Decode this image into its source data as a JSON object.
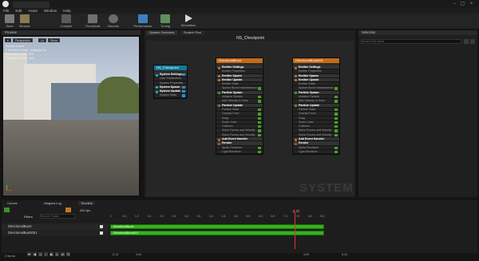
{
  "window": {
    "minimize": "−",
    "maximize": "▢",
    "close": "×"
  },
  "menu": [
    "File",
    "Edit",
    "Asset",
    "Window",
    "Help"
  ],
  "toolbar": {
    "save": "Save",
    "browse": "Browse",
    "thumbnail": "Thumbnail",
    "bounds": "Bounds",
    "performance": "Performance",
    "tuning": "Tuning",
    "simulation": "Simulation",
    "compile": "Compile"
  },
  "preview": {
    "tab": "Preview",
    "btn_persp": "Perspective",
    "btn_lit": "Lit",
    "btn_show": "Show",
    "lines": [
      "Particle Count",
      "0 (Particles Stats) - Instance No",
      "Expected Count - N/A",
      "Estimated Count - N/A"
    ]
  },
  "graph": {
    "tab": "System Overview",
    "scratch_tab": "Scratch Pad",
    "title": "NS_Checkpoint",
    "watermark": "SYSTEM"
  },
  "system_node": {
    "title": "NS_Checkpoint",
    "rows": [
      {
        "label": "System Settings",
        "type": "sec",
        "dot": "#2fb3d6",
        "chk": "b"
      },
      {
        "label": "User Parameters",
        "type": "mod",
        "dot": "",
        "chk": ""
      },
      {
        "label": "System Properties",
        "type": "mod",
        "dot": "",
        "chk": ""
      },
      {
        "label": "System Spawn",
        "type": "sec",
        "dot": "#2fb3d6",
        "chk": "b"
      },
      {
        "label": "System Update",
        "type": "sec",
        "dot": "#2fb3d6",
        "chk": "b"
      },
      {
        "label": "System State",
        "type": "mod",
        "dot": "",
        "chk": "b"
      }
    ]
  },
  "emitter_nodes": [
    {
      "title": "DirectionalBurst",
      "rows": [
        {
          "label": "Emitter Settings",
          "type": "sec",
          "dot": "#c9742a",
          "chk": ""
        },
        {
          "label": "Emitter Properties",
          "type": "mod",
          "dot": "",
          "chk": ""
        },
        {
          "label": "Emitter Spawn",
          "type": "sec",
          "dot": "#c9742a",
          "chk": ""
        },
        {
          "label": "Emitter Update",
          "type": "sec",
          "dot": "#c9742a",
          "chk": ""
        },
        {
          "label": "Emitter State",
          "type": "mod",
          "dot": "",
          "chk": ""
        },
        {
          "label": "Spawn Burst Instantaneous",
          "type": "mod",
          "dot": "",
          "chk": "g"
        },
        {
          "label": "Particle Spawn",
          "type": "sec",
          "dot": "#4aa02c",
          "chk": ""
        },
        {
          "label": "Initialize Particle",
          "type": "mod",
          "dot": "",
          "chk": "g"
        },
        {
          "label": "Add Velocity in Cone",
          "type": "mod",
          "dot": "",
          "chk": "g"
        },
        {
          "label": "Particle Update",
          "type": "sec",
          "dot": "#4aa02c",
          "chk": ""
        },
        {
          "label": "Particle State",
          "type": "mod",
          "dot": "",
          "chk": "g"
        },
        {
          "label": "Gravity Force",
          "type": "mod",
          "dot": "",
          "chk": "g"
        },
        {
          "label": "Drag",
          "type": "mod",
          "dot": "",
          "chk": "g"
        },
        {
          "label": "Scale Color",
          "type": "mod",
          "dot": "",
          "chk": "g"
        },
        {
          "label": "Collision",
          "type": "mod",
          "dot": "",
          "chk": "g"
        },
        {
          "label": "Solve Forces and Velocity",
          "type": "mod",
          "dot": "",
          "chk": "g"
        },
        {
          "label": "Solve Forces and Velocity",
          "type": "mod",
          "dot": "",
          "chk": "g"
        },
        {
          "label": "Add Event Handler",
          "type": "sec",
          "dot": "#c9742a",
          "chk": ""
        },
        {
          "label": "Render",
          "type": "sec",
          "dot": "#c94a3a",
          "chk": ""
        },
        {
          "label": "Sprite Renderer",
          "type": "mod",
          "dot": "",
          "chk": "g"
        },
        {
          "label": "Light Renderer",
          "type": "mod",
          "dot": "",
          "chk": "g"
        }
      ]
    },
    {
      "title": "DirectionalBurst001",
      "rows": [
        {
          "label": "Emitter Settings",
          "type": "sec",
          "dot": "#c9742a",
          "chk": ""
        },
        {
          "label": "Emitter Properties",
          "type": "mod",
          "dot": "",
          "chk": ""
        },
        {
          "label": "Emitter Spawn",
          "type": "sec",
          "dot": "#c9742a",
          "chk": ""
        },
        {
          "label": "Emitter Update",
          "type": "sec",
          "dot": "#c9742a",
          "chk": ""
        },
        {
          "label": "Emitter State",
          "type": "mod",
          "dot": "",
          "chk": ""
        },
        {
          "label": "Spawn Burst Instantaneous",
          "type": "mod",
          "dot": "",
          "chk": "g"
        },
        {
          "label": "Particle Spawn",
          "type": "sec",
          "dot": "#4aa02c",
          "chk": ""
        },
        {
          "label": "Initialize Particle",
          "type": "mod",
          "dot": "",
          "chk": "g"
        },
        {
          "label": "Add Velocity in Cone",
          "type": "mod",
          "dot": "",
          "chk": "g"
        },
        {
          "label": "Particle Update",
          "type": "sec",
          "dot": "#4aa02c",
          "chk": ""
        },
        {
          "label": "Particle State",
          "type": "mod",
          "dot": "",
          "chk": "g"
        },
        {
          "label": "Gravity Force",
          "type": "mod",
          "dot": "",
          "chk": "g"
        },
        {
          "label": "Drag",
          "type": "mod",
          "dot": "",
          "chk": "g"
        },
        {
          "label": "Scale Color",
          "type": "mod",
          "dot": "",
          "chk": "g"
        },
        {
          "label": "Collision",
          "type": "mod",
          "dot": "",
          "chk": "g"
        },
        {
          "label": "Solve Forces and Velocity",
          "type": "mod",
          "dot": "",
          "chk": "g"
        },
        {
          "label": "Solve Forces and Velocity",
          "type": "mod",
          "dot": "",
          "chk": "g"
        },
        {
          "label": "Add Event Handler",
          "type": "sec",
          "dot": "#c9742a",
          "chk": ""
        },
        {
          "label": "Render",
          "type": "sec",
          "dot": "#c94a3a",
          "chk": ""
        },
        {
          "label": "Sprite Renderer",
          "type": "mod",
          "dot": "",
          "chk": "g"
        },
        {
          "label": "Light Renderer",
          "type": "mod",
          "dot": "",
          "chk": "g"
        }
      ]
    }
  ],
  "selection": {
    "tab": "Selection",
    "search_placeholder": "Search the stack"
  },
  "timeline": {
    "tabs": [
      "Curves",
      "Niagara Log",
      "Timeline"
    ],
    "filters": "Filters",
    "search_placeholder": "Search Tracks",
    "fps": "240 fps",
    "playhead": "0.72",
    "tracks": [
      "DirectionalBurst",
      "DirectionalBurst001"
    ],
    "bars": [
      "DirectionalBurst",
      "DirectionalBurst001"
    ],
    "ticks": [
      "0",
      "0.5",
      "1.0",
      "1.5",
      "2.0",
      "2.5",
      "3.0",
      "3.5",
      "4.0",
      "4.5",
      "5.0",
      "5.5",
      "6.0",
      "6.5",
      "7.0",
      "7.5",
      "8.0",
      "8.5"
    ],
    "range": [
      "-0.13",
      "0.00",
      "4.00",
      "5.13"
    ],
    "items": "2 items"
  },
  "colors": {
    "accent": "#35b21a",
    "emitter_header": "#c46a1a",
    "system_header": "#11799b"
  }
}
